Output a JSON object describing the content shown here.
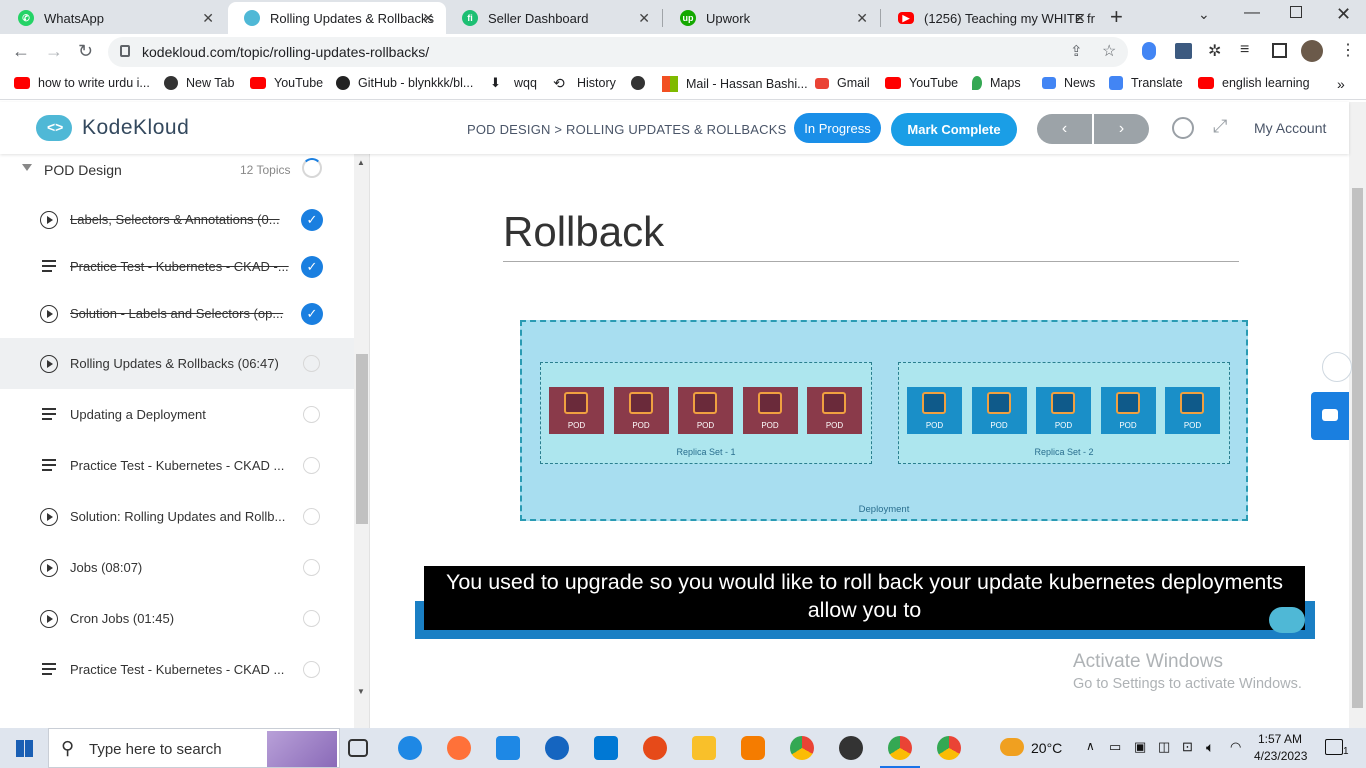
{
  "browser": {
    "tabs": [
      {
        "title": "WhatsApp",
        "color": "#25d366",
        "active": false
      },
      {
        "title": "Rolling Updates & Rollbacks",
        "color": "#4fb8d6",
        "active": true
      },
      {
        "title": "Seller Dashboard",
        "color": "#1dbf73",
        "active": false
      },
      {
        "title": "Upwork",
        "color": "#14a800",
        "active": false
      },
      {
        "title": "(1256) Teaching my WHITE fr",
        "color": "#ff0000",
        "active": false
      }
    ],
    "new_tab_label": "+",
    "url": "kodekloud.com/topic/rolling-updates-rollbacks/",
    "bookmarks": [
      "how to write urdu i...",
      "New Tab",
      "YouTube",
      "GitHub - blynkkk/bl...",
      "wqq",
      "History",
      "",
      "Mail - Hassan Bashi...",
      "Gmail",
      "YouTube",
      "Maps",
      "News",
      "Translate",
      "english learning"
    ]
  },
  "header": {
    "logo_text": "KodeKloud",
    "breadcrumb": "POD DESIGN > ROLLING UPDATES & ROLLBACKS",
    "in_progress_label": "In Progress",
    "mark_complete_label": "Mark Complete",
    "prev_label": "‹",
    "next_label": "›",
    "my_account_label": "My Account"
  },
  "sidebar": {
    "section_title": "POD Design",
    "section_count": "12 Topics",
    "lessons": [
      {
        "title": "Labels, Selectors & Annotations (0...",
        "type": "video",
        "done": true
      },
      {
        "title": "Practice Test - Kubernetes - CKAD -...",
        "type": "doc",
        "done": true
      },
      {
        "title": "Solution - Labels and Selectors (op...",
        "type": "video",
        "done": true
      },
      {
        "title": "Rolling Updates & Rollbacks (06:47)",
        "type": "video",
        "done": false,
        "current": true
      },
      {
        "title": "Updating a Deployment",
        "type": "doc",
        "done": false
      },
      {
        "title": "Practice Test - Kubernetes - CKAD ...",
        "type": "doc",
        "done": false
      },
      {
        "title": "Solution: Rolling Updates and Rollb...",
        "type": "video",
        "done": false
      },
      {
        "title": "Jobs (08:07)",
        "type": "video",
        "done": false
      },
      {
        "title": "Cron Jobs (01:45)",
        "type": "video",
        "done": false
      },
      {
        "title": "Practice Test - Kubernetes - CKAD ...",
        "type": "doc",
        "done": false
      }
    ]
  },
  "slide": {
    "title": "Rollback",
    "pod_label": "POD",
    "replica_set_1": "Replica Set - 1",
    "replica_set_2": "Replica Set - 2",
    "deployment_label": "Deployment",
    "caption": "You used to upgrade so you would like to roll back your update kubernetes deployments allow you to",
    "old_pod_color": "#8a3a4a",
    "new_pod_color": "#1a8fc8"
  },
  "watermark": {
    "line1": "Activate Windows",
    "line2": "Go to Settings to activate Windows."
  },
  "taskbar": {
    "search_placeholder": "Type here to search",
    "temperature": "20°C",
    "time": "1:57 AM",
    "date": "4/23/2023",
    "notification_count": "1"
  }
}
